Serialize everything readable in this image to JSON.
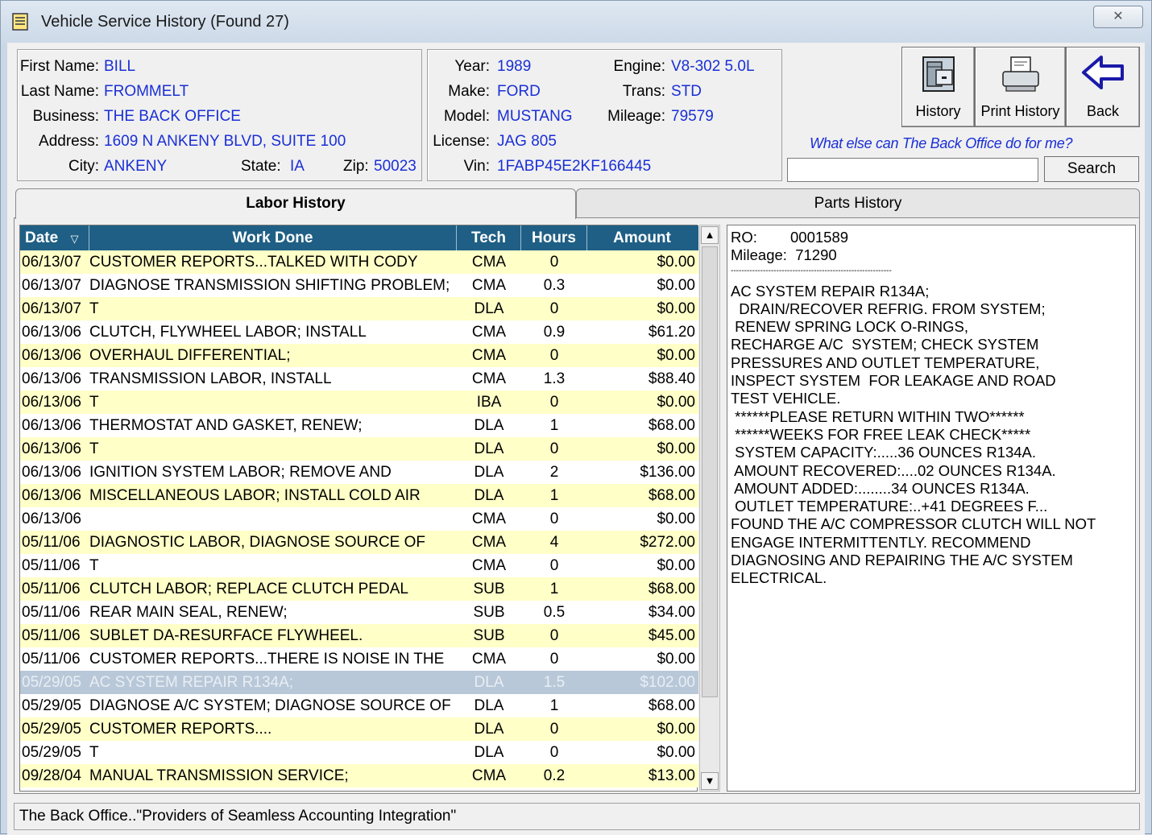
{
  "window": {
    "title": "Vehicle Service History (Found 27)",
    "close_label": "✕"
  },
  "customer": {
    "first_name_label": "First Name:",
    "first_name": "BILL",
    "last_name_label": "Last Name:",
    "last_name": "FROMMELT",
    "business_label": "Business:",
    "business": "THE BACK OFFICE",
    "address_label": "Address:",
    "address": "1609 N ANKENY BLVD, SUITE 100",
    "city_label": "City:",
    "city": "ANKENY",
    "state_label": "State:",
    "state": "IA",
    "zip_label": "Zip:",
    "zip": "50023"
  },
  "vehicle": {
    "year_label": "Year:",
    "year": "1989",
    "make_label": "Make:",
    "make": "FORD",
    "model_label": "Model:",
    "model": "MUSTANG",
    "license_label": "License:",
    "license": "JAG 805",
    "vin_label": "Vin:",
    "vin": "1FABP45E2KF166445",
    "engine_label": "Engine:",
    "engine": "V8-302  5.0L",
    "trans_label": "Trans:",
    "trans": "STD",
    "mileage_label": "Mileage:",
    "mileage": "79579"
  },
  "toolbar": {
    "history_label": "History",
    "print_history_label": "Print History",
    "back_label": "Back"
  },
  "help": {
    "tagline": "What else can The Back Office do for me?",
    "search_value": "",
    "search_label": "Search"
  },
  "tabs": [
    {
      "label": "Labor History",
      "active": true
    },
    {
      "label": "Parts History",
      "active": false
    }
  ],
  "grid": {
    "headers": {
      "date": "Date",
      "sort_glyph": "▽",
      "work": "Work Done",
      "tech": "Tech",
      "hours": "Hours",
      "amount": "Amount"
    },
    "rows": [
      {
        "date": "06/13/07",
        "work": "CUSTOMER REPORTS...TALKED WITH CODY",
        "tech": "CMA",
        "hours": "0",
        "amount": "$0.00"
      },
      {
        "date": "06/13/07",
        "work": "DIAGNOSE TRANSMISSION SHIFTING PROBLEM;",
        "tech": "CMA",
        "hours": "0.3",
        "amount": "$0.00"
      },
      {
        "date": "06/13/07",
        "work": "T",
        "tech": "DLA",
        "hours": "0",
        "amount": "$0.00"
      },
      {
        "date": "06/13/06",
        "work": "CLUTCH, FLYWHEEL LABOR; INSTALL",
        "tech": "CMA",
        "hours": "0.9",
        "amount": "$61.20"
      },
      {
        "date": "06/13/06",
        "work": "OVERHAUL DIFFERENTIAL;",
        "tech": "CMA",
        "hours": "0",
        "amount": "$0.00"
      },
      {
        "date": "06/13/06",
        "work": "TRANSMISSION LABOR, INSTALL",
        "tech": "CMA",
        "hours": "1.3",
        "amount": "$88.40"
      },
      {
        "date": "06/13/06",
        "work": "T",
        "tech": "IBA",
        "hours": "0",
        "amount": "$0.00"
      },
      {
        "date": "06/13/06",
        "work": "THERMOSTAT AND GASKET, RENEW;",
        "tech": "DLA",
        "hours": "1",
        "amount": "$68.00"
      },
      {
        "date": "06/13/06",
        "work": "T",
        "tech": "DLA",
        "hours": "0",
        "amount": "$0.00"
      },
      {
        "date": "06/13/06",
        "work": "IGNITION SYSTEM LABOR; REMOVE AND",
        "tech": "DLA",
        "hours": "2",
        "amount": "$136.00"
      },
      {
        "date": "06/13/06",
        "work": "MISCELLANEOUS LABOR; INSTALL COLD AIR",
        "tech": "DLA",
        "hours": "1",
        "amount": "$68.00"
      },
      {
        "date": "06/13/06",
        "work": "",
        "tech": "CMA",
        "hours": "0",
        "amount": "$0.00"
      },
      {
        "date": "05/11/06",
        "work": "DIAGNOSTIC LABOR, DIAGNOSE SOURCE OF",
        "tech": "CMA",
        "hours": "4",
        "amount": "$272.00"
      },
      {
        "date": "05/11/06",
        "work": "T",
        "tech": "CMA",
        "hours": "0",
        "amount": "$0.00"
      },
      {
        "date": "05/11/06",
        "work": "CLUTCH LABOR; REPLACE CLUTCH PEDAL",
        "tech": "SUB",
        "hours": "1",
        "amount": "$68.00"
      },
      {
        "date": "05/11/06",
        "work": "REAR MAIN SEAL, RENEW;",
        "tech": "SUB",
        "hours": "0.5",
        "amount": "$34.00"
      },
      {
        "date": "05/11/06",
        "work": "SUBLET DA-RESURFACE FLYWHEEL.",
        "tech": "SUB",
        "hours": "0",
        "amount": "$45.00"
      },
      {
        "date": "05/11/06",
        "work": "CUSTOMER REPORTS...THERE IS NOISE IN THE",
        "tech": "CMA",
        "hours": "0",
        "amount": "$0.00"
      },
      {
        "date": "05/29/05",
        "work": "AC SYSTEM REPAIR R134A;",
        "tech": "DLA",
        "hours": "1.5",
        "amount": "$102.00",
        "selected": true
      },
      {
        "date": "05/29/05",
        "work": "DIAGNOSE A/C SYSTEM; DIAGNOSE SOURCE OF",
        "tech": "DLA",
        "hours": "1",
        "amount": "$68.00"
      },
      {
        "date": "05/29/05",
        "work": "CUSTOMER REPORTS....",
        "tech": "DLA",
        "hours": "0",
        "amount": "$0.00"
      },
      {
        "date": "05/29/05",
        "work": "T",
        "tech": "DLA",
        "hours": "0",
        "amount": "$0.00"
      },
      {
        "date": "09/28/04",
        "work": " MANUAL TRANSMISSION SERVICE;",
        "tech": "CMA",
        "hours": "0.2",
        "amount": "$13.00"
      }
    ]
  },
  "detail": {
    "lines": [
      "RO:        0001589",
      "Mileage:  71290",
      "------------------------------------------------------------",
      "AC SYSTEM REPAIR R134A;",
      "  DRAIN/RECOVER REFRIG. FROM SYSTEM;",
      " RENEW SPRING LOCK O-RINGS,",
      "RECHARGE A/C  SYSTEM; CHECK SYSTEM",
      "PRESSURES AND OUTLET TEMPERATURE,",
      "INSPECT SYSTEM  FOR LEAKAGE AND ROAD",
      "TEST VEHICLE.",
      " ******PLEASE RETURN WITHIN TWO******",
      " ******WEEKS FOR FREE LEAK CHECK*****",
      " SYSTEM CAPACITY:.....36 OUNCES R134A.",
      " AMOUNT RECOVERED:....02 OUNCES R134A.",
      " AMOUNT ADDED:........34 OUNCES R134A.",
      " OUTLET TEMPERATURE:..+41 DEGREES F...",
      "FOUND THE A/C COMPRESSOR CLUTCH WILL NOT",
      "ENGAGE INTERMITTENTLY. RECOMMEND",
      "DIAGNOSING AND REPAIRING THE A/C SYSTEM",
      "ELECTRICAL."
    ]
  },
  "status": {
    "text": "The Back Office..\"Providers of Seamless Accounting Integration\""
  },
  "colors": {
    "header_bg": "#1f5f85",
    "row_alt": "#ffffc8",
    "value_text": "#1a2fd6",
    "selected_row": "#b8c8d8"
  }
}
